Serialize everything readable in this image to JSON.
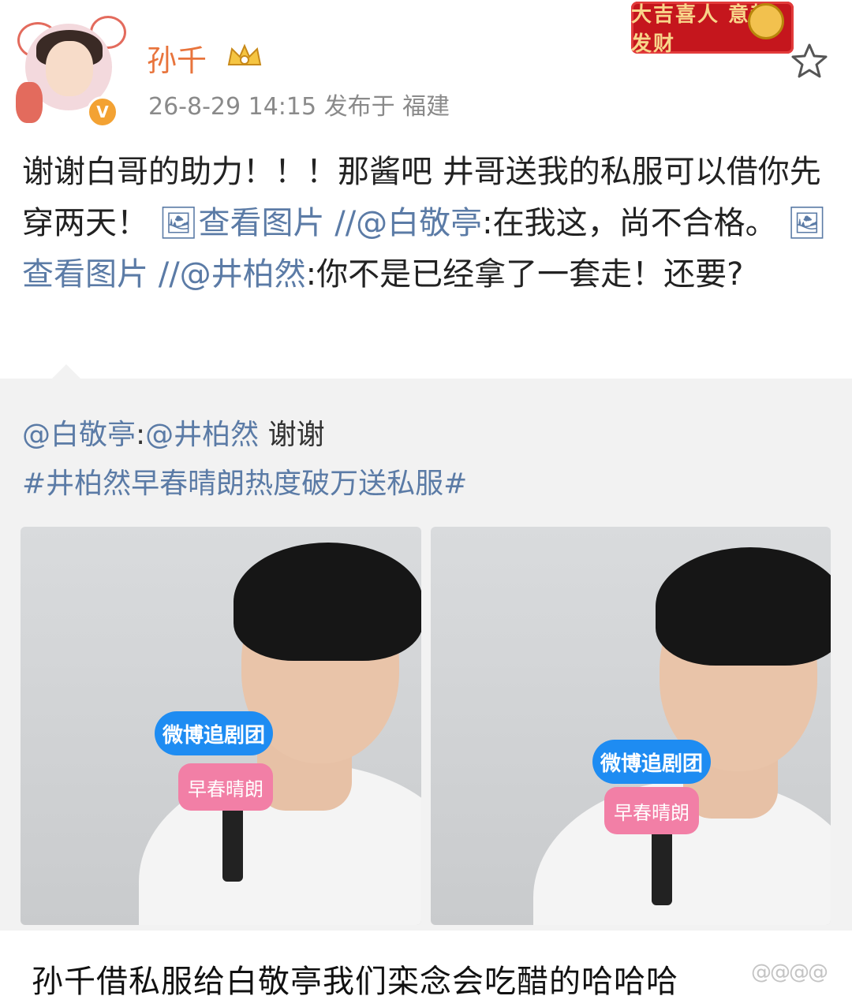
{
  "post": {
    "username": "孙千",
    "meta": "26-8-29 14:15  发布于 福建",
    "banner_text": "大吉喜人 意起发财",
    "text_segments": [
      {
        "t": "谢谢白哥的助力！！！那酱吧 井哥送我的私服可以借你先穿两天！ ",
        "link": false
      },
      {
        "t": "🖼查看图片",
        "link": true
      },
      {
        "t": " ",
        "link": false
      },
      {
        "t": "//@白敬亭",
        "link": true
      },
      {
        "t": ":在我这，尚不合格。 ",
        "link": false
      },
      {
        "t": "🖼查看图片",
        "link": true
      },
      {
        "t": " ",
        "link": false
      },
      {
        "t": "//@井柏然",
        "link": true
      },
      {
        "t": ":你不是已经拿了一套走！还要?",
        "link": false
      }
    ]
  },
  "retweet": {
    "line1_mention": "@白敬亭",
    "line1_sep": ":",
    "line1_mention2": "@井柏然",
    "line1_text": " 谢谢",
    "hashtag": "#井柏然早春晴朗热度破万送私服#",
    "mic_label": "微博追剧团",
    "mic_pink_label": "早春晴朗"
  },
  "caption": "孙千借私服给白敬亭我们栾念会吃醋的哈哈哈",
  "watermark": "@@@@",
  "icons": [
    "avatar",
    "vip-badge-icon",
    "crown-icon",
    "star-icon"
  ],
  "colors": {
    "username": "#e8743c",
    "link": "#5b7ba6",
    "banner": "#c5161d"
  }
}
